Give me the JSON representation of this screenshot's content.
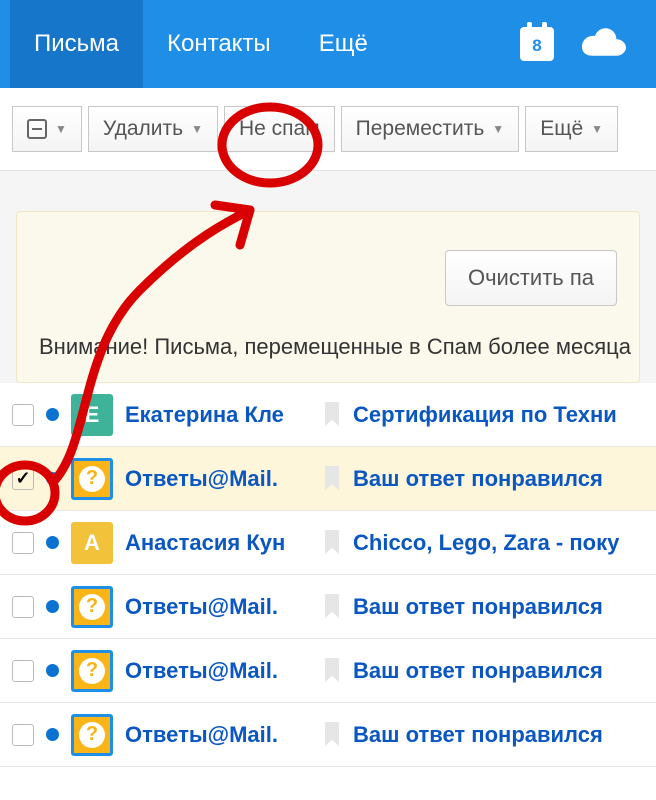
{
  "nav": {
    "mail": "Письма",
    "contacts": "Контакты",
    "more": "Ещё",
    "calendar_day": "8"
  },
  "toolbar": {
    "delete": "Удалить",
    "not_spam": "Не спам",
    "move": "Переместить",
    "more": "Ещё"
  },
  "notice": {
    "clear": "Очистить па",
    "text": "Внимание! Письма, перемещенные в Спам более месяца"
  },
  "rows": [
    {
      "sender": "Екатерина Кле",
      "subject": "Сертификация по Техни"
    },
    {
      "sender": "Ответы@Mail.",
      "subject": "Ваш ответ понравился"
    },
    {
      "sender": "Анастасия Кун",
      "subject": "Chicco, Lego, Zara - поку"
    },
    {
      "sender": "Ответы@Mail.",
      "subject": "Ваш ответ понравился"
    },
    {
      "sender": "Ответы@Mail.",
      "subject": "Ваш ответ понравился"
    },
    {
      "sender": "Ответы@Mail.",
      "subject": "Ваш ответ понравился"
    }
  ]
}
